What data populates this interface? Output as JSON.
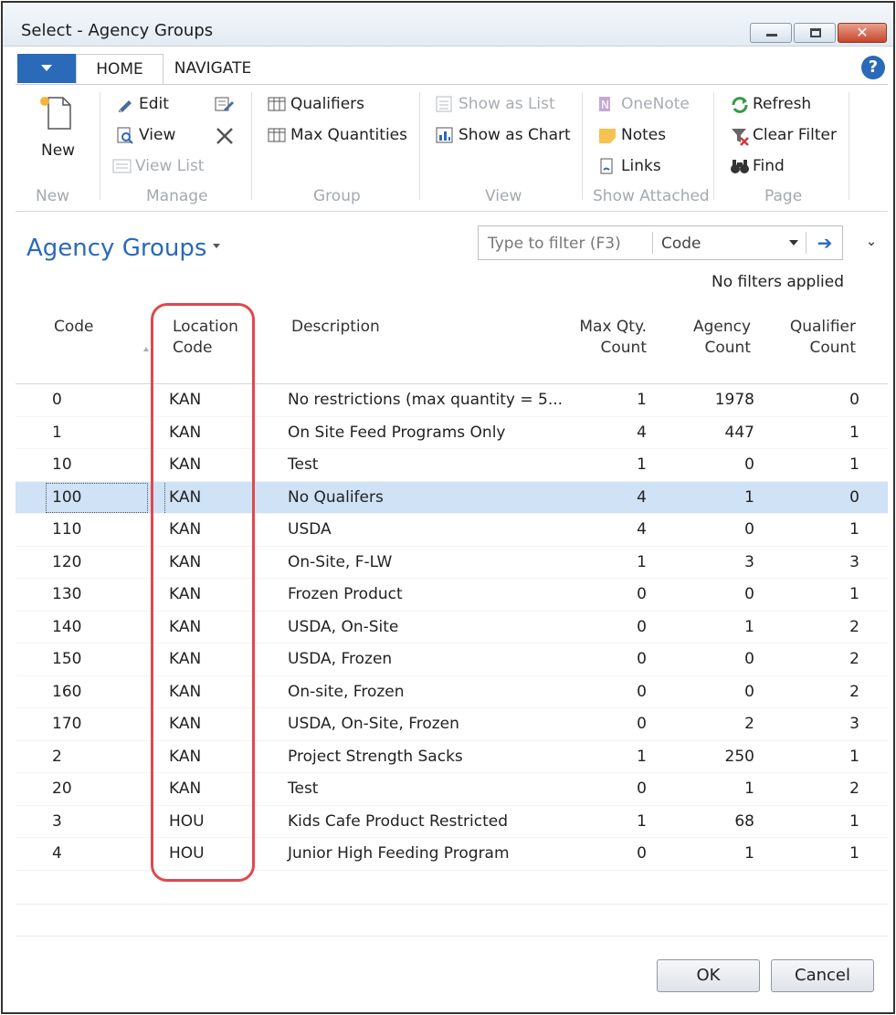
{
  "window": {
    "title": "Select - Agency Groups",
    "help_glyph": "?"
  },
  "ribbon": {
    "tabs": [
      {
        "label": "HOME",
        "active": true
      },
      {
        "label": "NAVIGATE",
        "active": false
      }
    ],
    "new": {
      "label": "New",
      "group": "New"
    },
    "manage": {
      "group": "Manage",
      "edit": "Edit",
      "view": "View",
      "view_list": "View List"
    },
    "group_group": {
      "group": "Group",
      "qualifiers": "Qualifiers",
      "max_quantities": "Max Quantities"
    },
    "view_group": {
      "group": "View",
      "show_as_list": "Show as List",
      "show_as_chart": "Show as Chart"
    },
    "show_attached": {
      "group": "Show Attached",
      "onenote": "OneNote",
      "notes": "Notes",
      "links": "Links"
    },
    "page": {
      "group": "Page",
      "refresh": "Refresh",
      "clear_filter": "Clear Filter",
      "find": "Find"
    }
  },
  "list": {
    "title": "Agency Groups",
    "filter": {
      "placeholder": "Type to filter (F3)",
      "field": "Code",
      "go_glyph": "➔",
      "status": "No filters applied"
    },
    "columns": {
      "code": "Code",
      "location_1": "Location",
      "location_2": "Code",
      "description": "Description",
      "maxqty_1": "Max Qty.",
      "maxqty_2": "Count",
      "agency_1": "Agency",
      "agency_2": "Count",
      "qualifier_1": "Qualifier",
      "qualifier_2": "Count"
    },
    "rows": [
      {
        "code": "0",
        "location": "KAN",
        "description": "No restrictions (max quantity = 5...",
        "max_qty": "1",
        "agency": "1978",
        "qualifier": "0"
      },
      {
        "code": "1",
        "location": "KAN",
        "description": "On Site Feed Programs Only",
        "max_qty": "4",
        "agency": "447",
        "qualifier": "1"
      },
      {
        "code": "10",
        "location": "KAN",
        "description": "Test",
        "max_qty": "1",
        "agency": "0",
        "qualifier": "1"
      },
      {
        "code": "100",
        "location": "KAN",
        "description": "No Qualifers",
        "max_qty": "4",
        "agency": "1",
        "qualifier": "0",
        "selected": true
      },
      {
        "code": "110",
        "location": "KAN",
        "description": "USDA",
        "max_qty": "4",
        "agency": "0",
        "qualifier": "1"
      },
      {
        "code": "120",
        "location": "KAN",
        "description": "On-Site, F-LW",
        "max_qty": "1",
        "agency": "3",
        "qualifier": "3"
      },
      {
        "code": "130",
        "location": "KAN",
        "description": "Frozen Product",
        "max_qty": "0",
        "agency": "0",
        "qualifier": "1"
      },
      {
        "code": "140",
        "location": "KAN",
        "description": "USDA, On-Site",
        "max_qty": "0",
        "agency": "1",
        "qualifier": "2"
      },
      {
        "code": "150",
        "location": "KAN",
        "description": "USDA, Frozen",
        "max_qty": "0",
        "agency": "0",
        "qualifier": "2"
      },
      {
        "code": "160",
        "location": "KAN",
        "description": "On-site, Frozen",
        "max_qty": "0",
        "agency": "0",
        "qualifier": "2"
      },
      {
        "code": "170",
        "location": "KAN",
        "description": "USDA, On-Site, Frozen",
        "max_qty": "0",
        "agency": "2",
        "qualifier": "3"
      },
      {
        "code": "2",
        "location": "KAN",
        "description": "Project Strength Sacks",
        "max_qty": "1",
        "agency": "250",
        "qualifier": "1"
      },
      {
        "code": "20",
        "location": "KAN",
        "description": "Test",
        "max_qty": "0",
        "agency": "1",
        "qualifier": "2"
      },
      {
        "code": "3",
        "location": "HOU",
        "description": "Kids Cafe Product Restricted",
        "max_qty": "1",
        "agency": "68",
        "qualifier": "1"
      },
      {
        "code": "4",
        "location": "HOU",
        "description": "Junior High Feeding Program",
        "max_qty": "0",
        "agency": "1",
        "qualifier": "1"
      }
    ]
  },
  "buttons": {
    "ok": "OK",
    "cancel": "Cancel"
  },
  "colors": {
    "accent": "#2a6ab8",
    "selection": "#cfe2f6",
    "annotation": "#e0484e"
  }
}
